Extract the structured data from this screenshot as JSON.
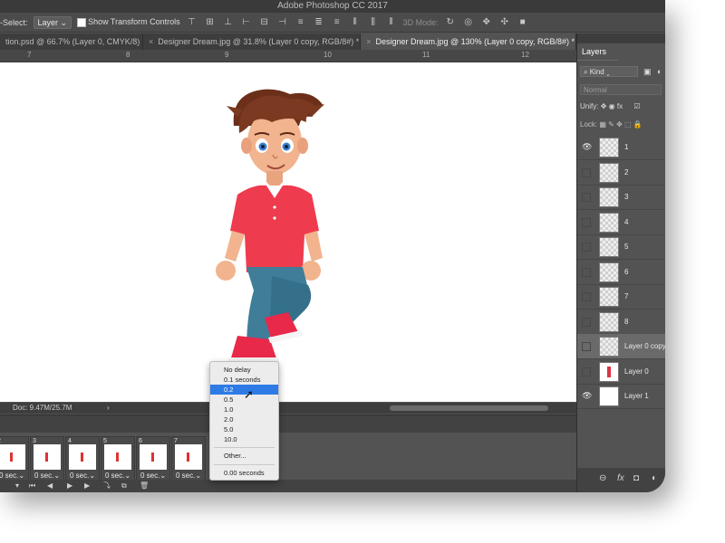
{
  "app": {
    "title": "Adobe Photoshop CC 2017"
  },
  "options_bar": {
    "auto_select_label": "-Select:",
    "auto_select_value": "Layer",
    "show_transform_label": "Show Transform Controls",
    "mode_3d_label": "3D Mode:"
  },
  "tabs": [
    {
      "label": "tion.psd @ 66.7% (Layer 0, CMYK/8)",
      "active": false
    },
    {
      "label": "Designer Dream.jpg @ 31.8% (Layer 0 copy, RGB/8#) *",
      "active": false
    },
    {
      "label": "Designer Dream.jpg @ 130% (Layer 0 copy, RGB/8#) *",
      "active": true
    }
  ],
  "ruler": {
    "ticks": [
      "7",
      "8",
      "9",
      "10",
      "11",
      "12"
    ]
  },
  "status": {
    "doc": "Doc: 9.47M/25.7M",
    "arrow": "›"
  },
  "timeline": {
    "frames": [
      {
        "num": "2",
        "delay": "0 sec."
      },
      {
        "num": "3",
        "delay": "0 sec."
      },
      {
        "num": "4",
        "delay": "0 sec."
      },
      {
        "num": "5",
        "delay": "0 sec."
      },
      {
        "num": "6",
        "delay": "0 sec."
      },
      {
        "num": "7",
        "delay": "0 sec."
      }
    ]
  },
  "delay_menu": {
    "items": [
      "No delay",
      "0.1 seconds",
      "0.2",
      "0.5",
      "1.0",
      "2.0",
      "5.0",
      "10.0"
    ],
    "selected": "0.2",
    "other": "Other...",
    "current": "0.00 seconds"
  },
  "layers_panel": {
    "tab": "Layers",
    "kind": "Kind",
    "blend_mode": "Normal",
    "unify_label": "Unify:",
    "lock_label": "Lock:",
    "layers": [
      {
        "name": "1",
        "visible": true,
        "thumb": "checker"
      },
      {
        "name": "2",
        "visible": false,
        "thumb": "checker"
      },
      {
        "name": "3",
        "visible": false,
        "thumb": "checker"
      },
      {
        "name": "4",
        "visible": false,
        "thumb": "checker"
      },
      {
        "name": "5",
        "visible": false,
        "thumb": "checker"
      },
      {
        "name": "6",
        "visible": false,
        "thumb": "checker"
      },
      {
        "name": "7",
        "visible": false,
        "thumb": "checker"
      },
      {
        "name": "8",
        "visible": false,
        "thumb": "checker"
      },
      {
        "name": "Layer 0 copy",
        "visible": false,
        "thumb": "checker",
        "selected": true
      },
      {
        "name": "Layer 0",
        "visible": false,
        "thumb": "guy"
      },
      {
        "name": "Layer 1",
        "visible": true,
        "thumb": "white"
      }
    ]
  }
}
